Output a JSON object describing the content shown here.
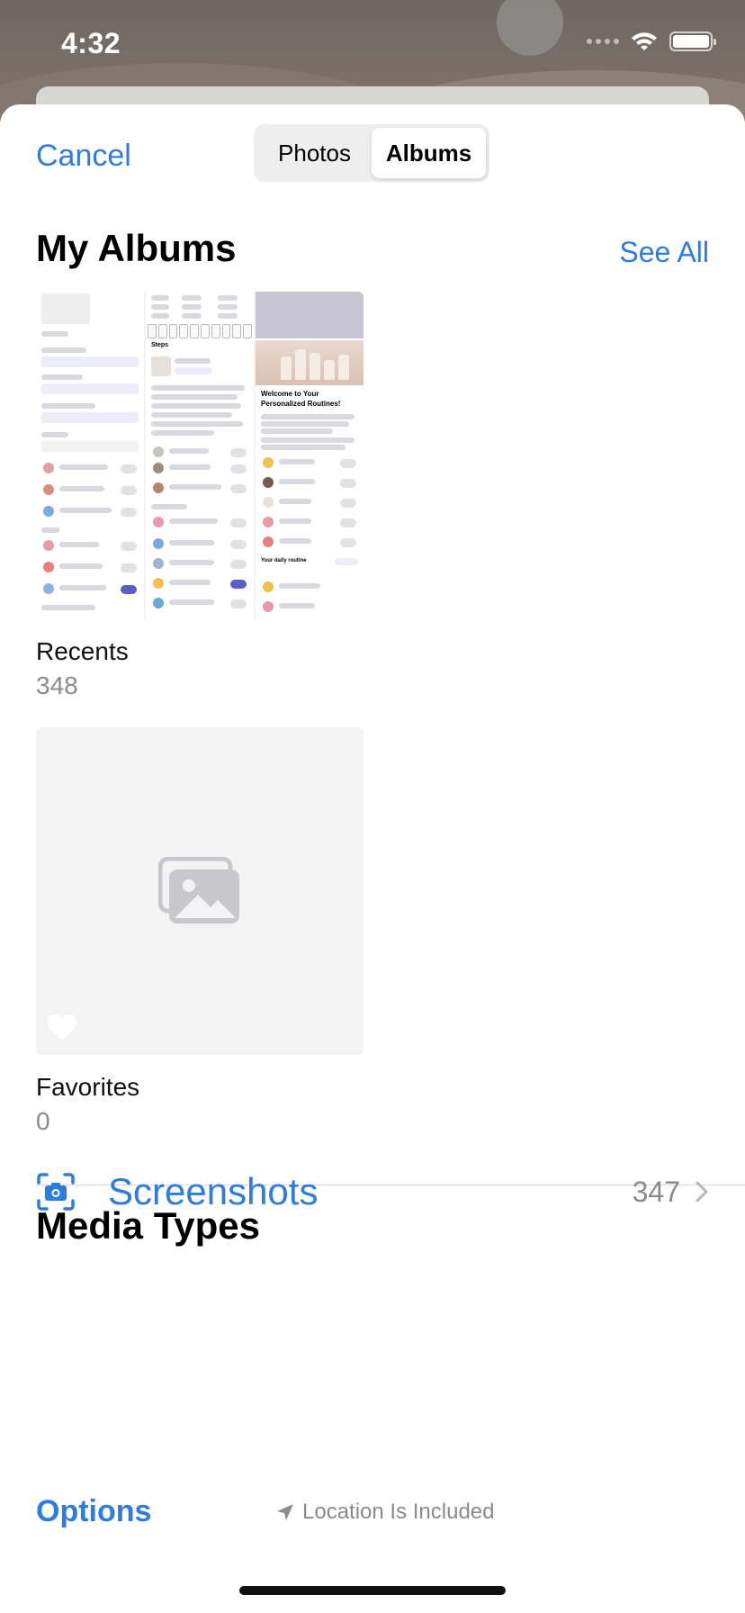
{
  "status_bar": {
    "time": "4:32"
  },
  "nav": {
    "cancel_label": "Cancel",
    "tabs": [
      {
        "label": "Photos",
        "selected": false
      },
      {
        "label": "Albums",
        "selected": true
      }
    ]
  },
  "my_albums": {
    "title": "My Albums",
    "see_all_label": "See All",
    "albums": [
      {
        "name": "Recents",
        "count": "348"
      },
      {
        "name": "Favorites",
        "count": "0"
      }
    ],
    "recents_thumbnail": {
      "heading": "Welcome to Your Personalized Routines!",
      "steps_label": "Steps",
      "daily_routine_label": "Your daily routine"
    }
  },
  "media_types": {
    "title": "Media Types",
    "items": [
      {
        "icon": "screenshot-icon",
        "label": "Screenshots",
        "count": "347"
      }
    ]
  },
  "footer": {
    "options_label": "Options",
    "location_text": "Location Is Included"
  },
  "colors": {
    "accent": "#2f7ce0",
    "secondary_text": "#8a8a8f",
    "toggle_on": "#5b5ec9"
  }
}
